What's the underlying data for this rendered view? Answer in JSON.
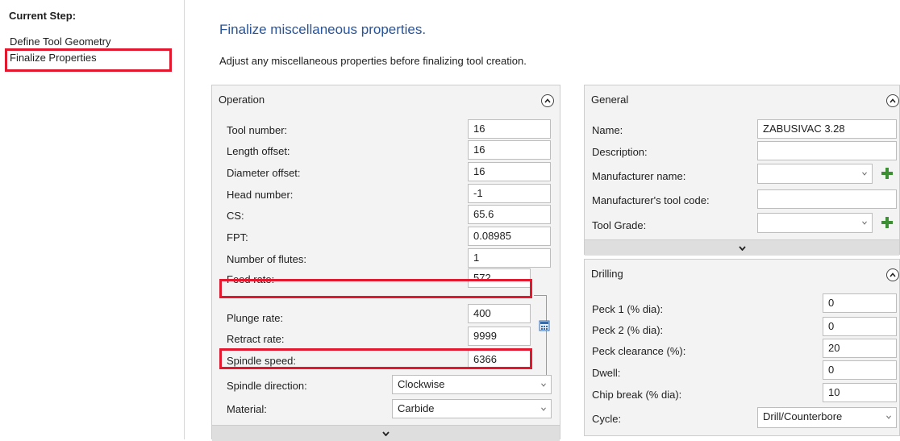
{
  "sidebar": {
    "title": "Current Step:",
    "steps": [
      "Define Tool Geometry",
      "Finalize Properties"
    ]
  },
  "main": {
    "heading": "Finalize miscellaneous properties.",
    "description": "Adjust any miscellaneous properties before finalizing tool creation."
  },
  "operation": {
    "title": "Operation",
    "fields": [
      {
        "label": "Tool number:",
        "value": "16"
      },
      {
        "label": "Length offset:",
        "value": "16"
      },
      {
        "label": "Diameter offset:",
        "value": "16"
      },
      {
        "label": "Head number:",
        "value": "-1"
      },
      {
        "label": "CS:",
        "value": "65.6"
      },
      {
        "label": "FPT:",
        "value": "0.08985"
      },
      {
        "label": "Number of flutes:",
        "value": "1"
      },
      {
        "label": "Feed rate:",
        "value": "572"
      },
      {
        "label": "Plunge rate:",
        "value": "400"
      },
      {
        "label": "Retract rate:",
        "value": "9999"
      },
      {
        "label": "Spindle speed:",
        "value": "6366"
      }
    ],
    "spindle_direction": {
      "label": "Spindle direction:",
      "value": "Clockwise"
    },
    "material": {
      "label": "Material:",
      "value": "Carbide"
    }
  },
  "general": {
    "title": "General",
    "name": {
      "label": "Name:",
      "value": "ZABUSIVAC 3.28"
    },
    "description": {
      "label": "Description:",
      "value": ""
    },
    "manufacturer_name": {
      "label": "Manufacturer name:",
      "value": ""
    },
    "manufacturer_code": {
      "label": "Manufacturer's tool code:",
      "value": ""
    },
    "tool_grade": {
      "label": "Tool Grade:",
      "value": ""
    }
  },
  "drilling": {
    "title": "Drilling",
    "fields": [
      {
        "label": "Peck 1 (% dia):",
        "value": "0"
      },
      {
        "label": "Peck 2 (% dia):",
        "value": "0"
      },
      {
        "label": "Peck clearance (%):",
        "value": "20"
      },
      {
        "label": "Dwell:",
        "value": "0"
      },
      {
        "label": "Chip break (% dia):",
        "value": "10"
      }
    ],
    "cycle": {
      "label": "Cycle:",
      "value": "Drill/Counterbore"
    }
  },
  "icons": [
    "chevron-up-icon",
    "chevron-down-icon",
    "dropdown-arrow-icon",
    "plus-icon",
    "calculator-icon"
  ],
  "colors": {
    "heading": "#27549a",
    "highlight": "#e3172d",
    "plus": "#3c8f33",
    "panel_bg": "#f3f3f3"
  }
}
